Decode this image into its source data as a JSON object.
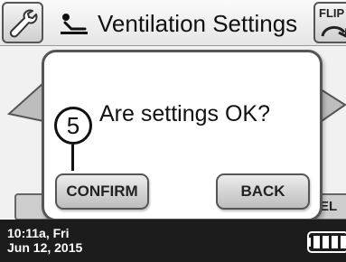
{
  "header": {
    "title": "Ventilation Settings",
    "flip_label": "FLIP",
    "left_icon": "wrench-icon",
    "title_icon": "patient-recline-icon"
  },
  "dialog": {
    "message": "Are settings OK?",
    "confirm_label": "CONFIRM",
    "back_label": "BACK"
  },
  "callout": {
    "number": "5"
  },
  "background": {
    "right_button_partial": "EL"
  },
  "status": {
    "time": "10:11a, Fri",
    "date": "Jun 12, 2015",
    "battery_icon": "battery-full-icon"
  }
}
